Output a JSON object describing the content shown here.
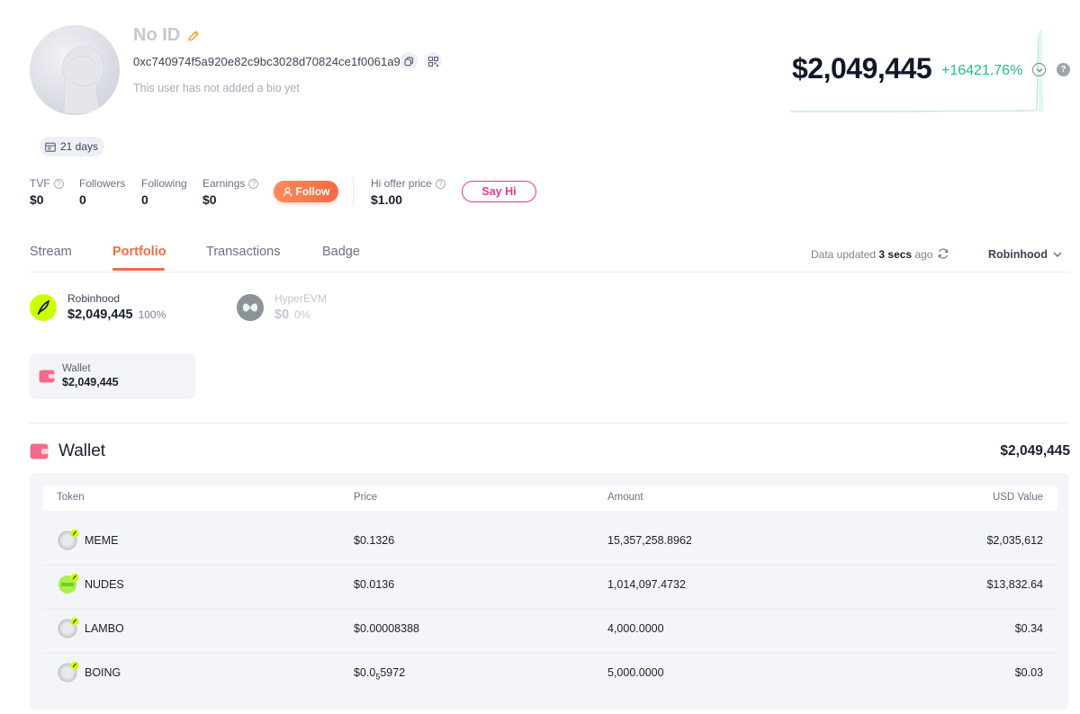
{
  "profile": {
    "name": "No ID",
    "address": "0xc740974f5a920e82c9bc3028d70824ce1f0061a9",
    "bio": "This user has not added a bio yet",
    "days": "21 days"
  },
  "stats": [
    {
      "label": "TVF",
      "value": "$0",
      "help": true
    },
    {
      "label": "Followers",
      "value": "0",
      "help": false
    },
    {
      "label": "Following",
      "value": "0",
      "help": false
    },
    {
      "label": "Earnings",
      "value": "$0",
      "help": true
    }
  ],
  "follow_label": "Follow",
  "offer": {
    "label": "Hi offer price",
    "value": "$1.00"
  },
  "sayhi_label": "Say Hi",
  "balance": {
    "total": "$2,049,445",
    "change": "+16421.76%"
  },
  "tabs": [
    {
      "label": "Stream",
      "active": false
    },
    {
      "label": "Portfolio",
      "active": true
    },
    {
      "label": "Transactions",
      "active": false
    },
    {
      "label": "Badge",
      "active": false
    }
  ],
  "updated": {
    "prefix": "Data updated",
    "time": "3 secs",
    "suffix": "ago"
  },
  "chain_select": "Robinhood",
  "chains": [
    {
      "name": "Robinhood",
      "value": "$2,049,445",
      "pct": "100%"
    },
    {
      "name": "HyperEVM",
      "value": "$0",
      "pct": "0%"
    }
  ],
  "wallet_card": {
    "label": "Wallet",
    "value": "$2,049,445"
  },
  "wallet_section": {
    "title": "Wallet",
    "total": "$2,049,445"
  },
  "table": {
    "headers": {
      "token": "Token",
      "price": "Price",
      "amount": "Amount",
      "usd": "USD Value"
    },
    "rows": [
      {
        "token": "MEME",
        "price": "$0.1326",
        "amount": "15,357,258.8962",
        "usd": "$2,035,612"
      },
      {
        "token": "NUDES",
        "price": "$0.0136",
        "amount": "1,014,097.4732",
        "usd": "$13,832.64"
      },
      {
        "token": "LAMBO",
        "price": "$0.00008388",
        "amount": "4,000.0000",
        "usd": "$0.34"
      },
      {
        "token": "BOING",
        "price_prefix": "$0.0",
        "price_sub": "5",
        "price_suffix": "5972",
        "amount": "5,000.0000",
        "usd": "$0.03"
      }
    ]
  },
  "colors": {
    "accent": "#f26b46",
    "positive": "#1fbf86",
    "sayhi": "#e0379a",
    "robinhood": "#ccff00"
  }
}
